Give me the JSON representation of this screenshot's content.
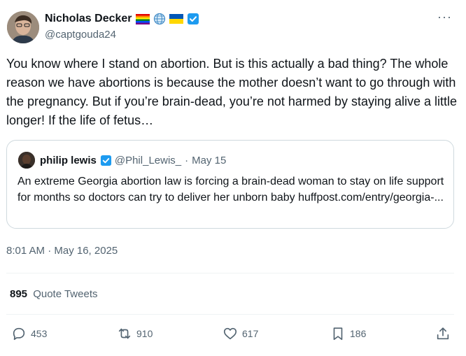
{
  "author": {
    "name": "Nicholas Decker",
    "handle": "@captgouda24",
    "icons": [
      "rainbow-flag-icon",
      "globe-icon",
      "ukraine-flag-icon",
      "verified-badge-icon"
    ]
  },
  "tweet": {
    "text": "You know where I stand on abortion. But is this actually a bad thing? The whole reason we have abortions is because the mother doesn’t want to go through with the pregnancy. But if you’re brain-dead, you’re not harmed by staying alive a little longer! If the life of fetus…",
    "timestamp": "8:01 AM · May 16, 2025"
  },
  "quoted": {
    "name": "philip lewis",
    "handle": "@Phil_Lewis_",
    "separator": "·",
    "date": "May 15",
    "text": "An extreme Georgia abortion law is forcing a brain-dead woman to stay on life support for months so doctors can try to deliver her unborn baby huffpost.com/entry/georgia-..."
  },
  "stats": {
    "quote_count": "895",
    "quote_label": "Quote Tweets"
  },
  "actions": {
    "replies": "453",
    "retweets": "910",
    "likes": "617",
    "bookmarks": "186"
  },
  "more_label": "···",
  "colors": {
    "text": "#0f1419",
    "secondary": "#536471",
    "border": "#cfd9de",
    "verified": "#1d9bf0"
  }
}
